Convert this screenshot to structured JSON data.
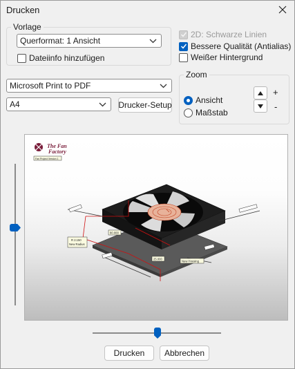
{
  "window": {
    "title": "Drucken"
  },
  "vorlage": {
    "label": "Vorlage",
    "template_value": "Querformat: 1 Ansicht",
    "dateiinfo_label": "Dateiinfo hinzufügen",
    "dateiinfo_checked": false
  },
  "options": {
    "schwarze_linien_label": "2D: Schwarze Linien",
    "schwarze_linien_checked": true,
    "schwarze_linien_disabled": true,
    "qualitaet_label": "Bessere Qualität (Antialias)",
    "qualitaet_checked": true,
    "hintergrund_label": "Weißer Hintergrund",
    "hintergrund_checked": false
  },
  "printer": {
    "name": "Microsoft Print to PDF",
    "paper": "A4",
    "setup_label": "Drucker-Setup"
  },
  "zoom": {
    "label": "Zoom",
    "ansicht_label": "Ansicht",
    "massstab_label": "Maßstab",
    "selected": "Ansicht",
    "plus": "+",
    "minus": "-"
  },
  "preview": {
    "logo_line1": "The Fan",
    "logo_line2": "Factory",
    "project_tag": "Fan Project Version 1",
    "labels": {
      "radius": "R 2.150",
      "radius_name": "New Radius",
      "width": "80.000",
      "depth": "25.000",
      "housing": "New Housing"
    }
  },
  "sliders": {
    "vertical_level": 0.45,
    "horizontal_level": 0.5
  },
  "buttons": {
    "print": "Drucken",
    "cancel": "Abbrechen"
  },
  "colors": {
    "accent": "#0060c0",
    "dimension_red": "#d01010"
  }
}
